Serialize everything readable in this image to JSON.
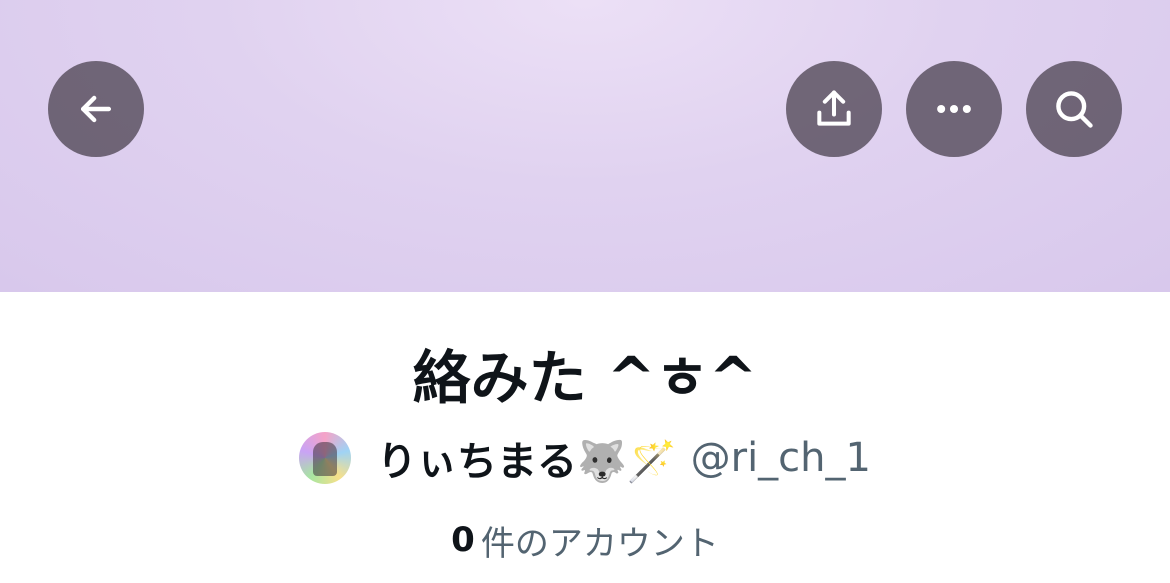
{
  "header": {
    "back_icon": "arrow-left-icon",
    "share_icon": "share-upload-icon",
    "more_icon": "ellipsis-icon",
    "search_icon": "search-icon",
    "banner_color": "#e3d5f2",
    "button_color": "#5a505e"
  },
  "list": {
    "title": "絡みた ^ㅎ^",
    "owner_name": "りぃちまる🐺🪄",
    "owner_handle": "@ri_ch_1",
    "member_count": "0",
    "member_count_label": "件のアカウント"
  }
}
